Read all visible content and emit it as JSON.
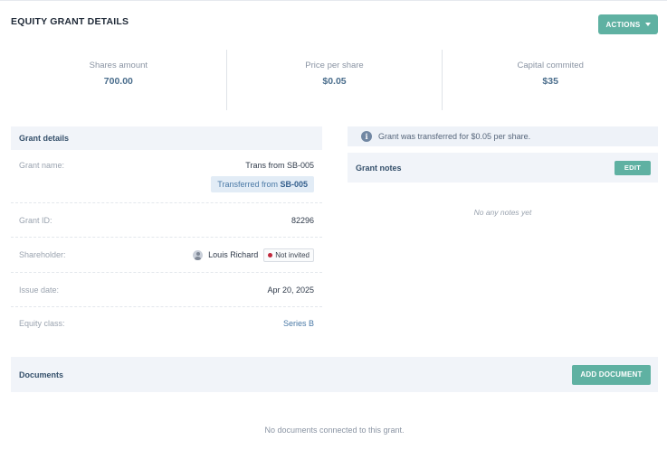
{
  "header": {
    "title": "EQUITY GRANT DETAILS",
    "actions_label": "ACTIONS"
  },
  "stats": [
    {
      "label": "Shares amount",
      "value": "700.00"
    },
    {
      "label": "Price per share",
      "value": "$0.05"
    },
    {
      "label": "Capital commited",
      "value": "$35"
    }
  ],
  "grant_details": {
    "title": "Grant details",
    "name_label": "Grant name:",
    "name_value": "Trans from SB-005",
    "transferred_prefix": "Transferred from",
    "transferred_code": "SB-005",
    "id_label": "Grant ID:",
    "id_value": "82296",
    "shareholder_label": "Shareholder:",
    "shareholder_name": "Louis Richard",
    "shareholder_status": "Not invited",
    "issue_label": "Issue date:",
    "issue_value": "Apr 20, 2025",
    "class_label": "Equity class:",
    "class_value": "Series B"
  },
  "info": {
    "message": "Grant was transferred for $0.05 per share."
  },
  "notes": {
    "title": "Grant notes",
    "edit_label": "EDIT",
    "empty": "No any notes yet"
  },
  "documents": {
    "title": "Documents",
    "add_label": "ADD DOCUMENT",
    "empty": "No documents connected to this grant."
  },
  "colors": {
    "accent": "#5fb1a2",
    "status_dot": "#c0283c",
    "link": "#4a79a6"
  }
}
